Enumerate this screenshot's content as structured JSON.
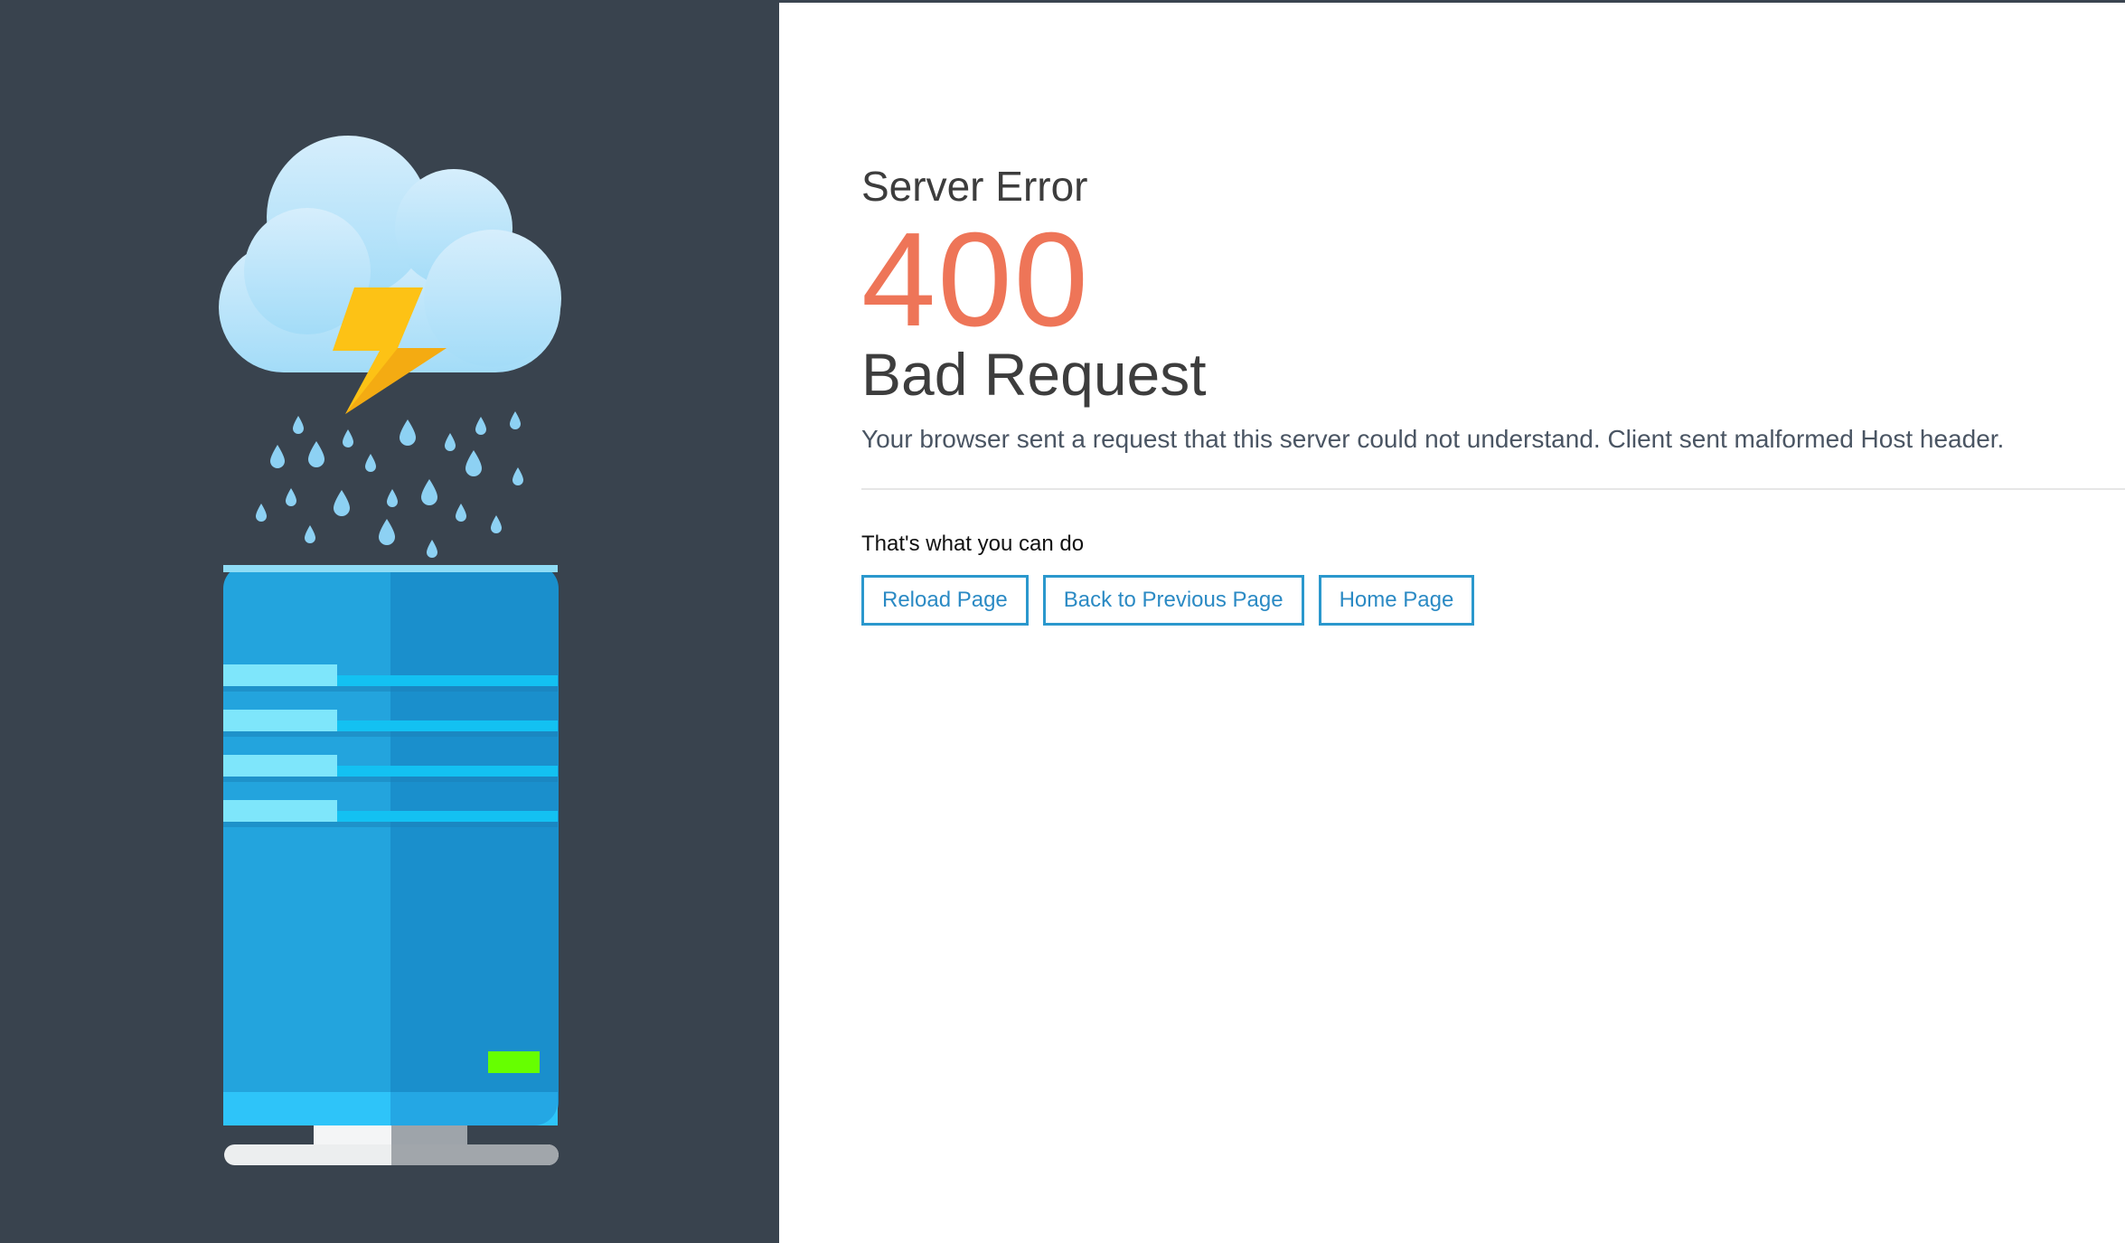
{
  "header": {
    "label": "Server Error",
    "code": "400",
    "title": "Bad Request",
    "message": "Your browser sent a request that this server could not understand. Client sent malformed Host header."
  },
  "actions": {
    "heading": "That's what you can do",
    "reload_label": "Reload Page",
    "back_label": "Back to Previous Page",
    "home_label": "Home Page"
  },
  "colors": {
    "left_panel_bg": "#39434e",
    "error_code": "#ee7558",
    "button_border": "#2b98cd",
    "status_light": "#66ff00"
  },
  "illustration": {
    "icons": [
      "cloud-icon",
      "lightning-bolt-icon",
      "rain-drops",
      "server-tower-icon"
    ]
  }
}
